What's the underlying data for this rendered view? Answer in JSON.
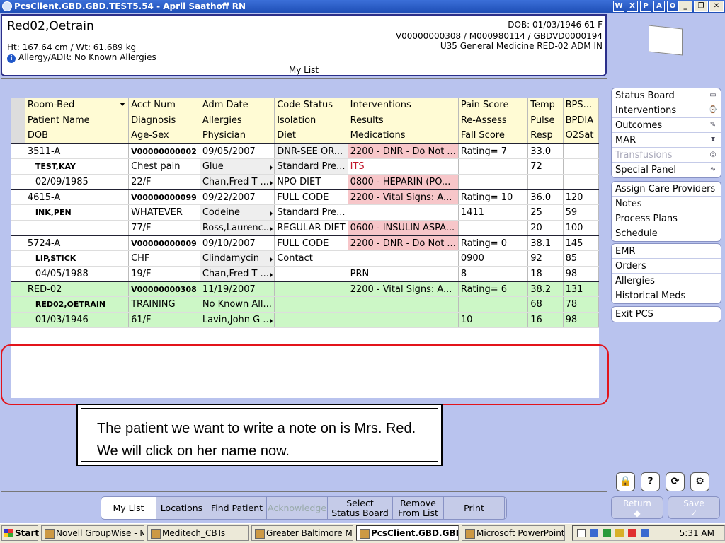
{
  "window": {
    "title": "PcsClient.GBD.GBD.TEST5.54 - April Saathoff RN"
  },
  "patient": {
    "name": "Red02,Oetrain",
    "dob_line": "DOB: 01/03/1946 61 F",
    "ids": "V00000000308 / M000980114 / GBDVD0000194",
    "location": "U35 General Medicine  RED-02  ADM IN",
    "htwt": "Ht: 167.64 cm / Wt: 61.689 kg",
    "allergy": "Allergy/ADR: No Known Allergies",
    "list_title": "My List"
  },
  "grid": {
    "headers": [
      [
        "Room-Bed",
        "Acct Num",
        "Adm Date",
        "Code Status",
        "Interventions",
        "Pain Score",
        "Temp",
        "BPS..."
      ],
      [
        "Patient Name",
        "Diagnosis",
        "Allergies",
        "Isolation",
        "Results",
        "Re-Assess",
        "Pulse",
        "BPDIA"
      ],
      [
        "DOB",
        "Age-Sex",
        "Physician",
        "Diet",
        "Medications",
        "Fall Score",
        "Resp",
        "O2Sat"
      ]
    ],
    "patients": [
      {
        "rows": [
          [
            "3511-A",
            "V00000000002",
            "09/05/2007",
            "DNR-SEE OR...",
            "2200 - DNR - Do Not ...",
            "Rating= 7",
            "33.0",
            ""
          ],
          [
            "TEST,KAY",
            "Chest pain",
            "Glue",
            "Standard Pre...",
            "ITS",
            "",
            "72",
            ""
          ],
          [
            "02/09/1985",
            "22/F",
            "Chan,Fred T ...",
            "NPO DIET",
            "0800 - HEPARIN (PO...",
            "",
            "",
            ""
          ]
        ]
      },
      {
        "rows": [
          [
            "4615-A",
            "V00000000099",
            "09/22/2007",
            "FULL CODE",
            "2200 - Vital Signs: A...",
            "Rating= 10",
            "36.0",
            "120"
          ],
          [
            "INK,PEN",
            "WHATEVER",
            "Codeine",
            "Standard Pre...",
            "",
            "1411",
            "25",
            "59"
          ],
          [
            "",
            "77/F",
            "Ross,Laurenc...",
            "REGULAR DIET",
            "0600 - INSULIN ASPA...",
            "",
            "20",
            "100"
          ]
        ]
      },
      {
        "rows": [
          [
            "5724-A",
            "V00000000009",
            "09/10/2007",
            "FULL CODE",
            "2200 - DNR - Do Not ...",
            "Rating= 0",
            "38.1",
            "145"
          ],
          [
            "LIP,STICK",
            "CHF",
            "Clindamycin",
            "Contact",
            "",
            "0900",
            "92",
            "85"
          ],
          [
            "04/05/1988",
            "19/F",
            "Chan,Fred T ...",
            "",
            "PRN",
            "8",
            "18",
            "98"
          ]
        ]
      },
      {
        "rows": [
          [
            "RED-02",
            "V00000000308",
            "11/19/2007",
            "",
            "2200 - Vital Signs: A...",
            "Rating= 6",
            "38.2",
            "131"
          ],
          [
            "RED02,OETRAIN",
            "TRAINING",
            "No Known All...",
            "",
            "",
            "",
            "68",
            "78"
          ],
          [
            "01/03/1946",
            "61/F",
            "Lavin,John G ...",
            "",
            "",
            "10",
            "16",
            "98"
          ]
        ]
      }
    ]
  },
  "callout": {
    "text": "The patient we want to write a note on is Mrs. Red. We will click on her name now."
  },
  "side": {
    "group1": [
      "Status Board",
      "Interventions",
      "Outcomes",
      "MAR",
      "Transfusions",
      "Special Panel"
    ],
    "group2": [
      "Assign Care Providers",
      "Notes",
      "Process Plans",
      "Schedule"
    ],
    "group3": [
      "EMR",
      "Orders",
      "Allergies",
      "Historical Meds"
    ],
    "group4": [
      "Exit PCS"
    ],
    "return_label": "Return",
    "save_label": "Save"
  },
  "bottom": {
    "tabs": [
      "My List",
      "Locations",
      "Find Patient",
      "Acknowledge",
      "Select Status Board",
      "Remove From List",
      "Print"
    ]
  },
  "taskbar": {
    "start": "Start",
    "tasks": [
      "Novell GroupWise - M...",
      "Meditech_CBTs",
      "Greater Baltimore Me...",
      "PcsClient.GBD.GBD....",
      "Microsoft PowerPoint ..."
    ],
    "clock": "5:31 AM"
  }
}
